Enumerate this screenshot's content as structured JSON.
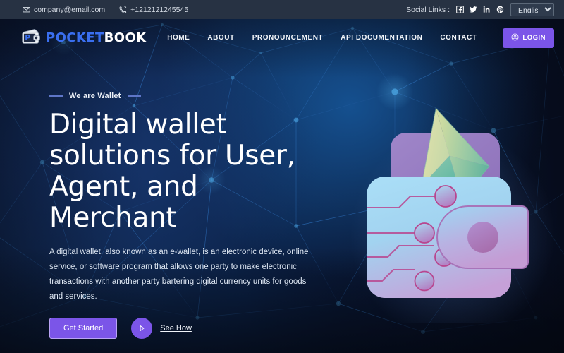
{
  "topbar": {
    "email": "company@email.com",
    "email_icon": "envelope-icon",
    "phone": "+1212121245545",
    "phone_icon": "phone-icon",
    "social_label": "Social Links :",
    "socials": [
      {
        "name": "facebook-icon",
        "label": "Facebook"
      },
      {
        "name": "twitter-icon",
        "label": "Twitter"
      },
      {
        "name": "linkedin-icon",
        "label": "LinkedIn"
      },
      {
        "name": "pinterest-icon",
        "label": "Pinterest"
      }
    ],
    "language_selected": "English",
    "language_options": [
      "English"
    ]
  },
  "brand": {
    "name_part1": "POCKET",
    "name_part2": "BOOK",
    "icon": "wallet-icon",
    "color_part1": "#3a6ff0",
    "color_part2": "#ffffff"
  },
  "nav": {
    "items": [
      {
        "label": "HOME"
      },
      {
        "label": "ABOUT"
      },
      {
        "label": "PRONOUNCEMENT"
      },
      {
        "label": "API DOCUMENTATION"
      },
      {
        "label": "CONTACT"
      }
    ],
    "login_label": "LOGIN",
    "login_icon": "user-circle-icon",
    "login_color": "#7b55e8"
  },
  "hero": {
    "eyebrow": "We are Wallet",
    "heading_line1": "Digital wallet",
    "heading_line2": "solutions for User,",
    "heading_line3": "Agent, and Merchant",
    "paragraph": "A digital wallet, also known as an e-wallet, is an electronic device, online service, or software program that allows one party to make electronic transactions with another party bartering digital currency units for goods and services.",
    "primary_cta": "Get Started",
    "secondary_cta": "See How",
    "play_icon": "play-icon",
    "accent_color": "#7b55e8"
  },
  "illustration": {
    "name": "digital-wallet-with-ethereum-illustration",
    "wallet_gradient_from": "#9fd9f5",
    "wallet_gradient_to": "#c9a2d8",
    "circuit_color": "#b8468f",
    "diamond_light": "#f0e3a8",
    "diamond_dark": "#63b7a4"
  },
  "theme": {
    "topbar_bg": "#273243",
    "hero_bg_dark": "#05070f",
    "hero_bg_blue": "#102a54"
  }
}
